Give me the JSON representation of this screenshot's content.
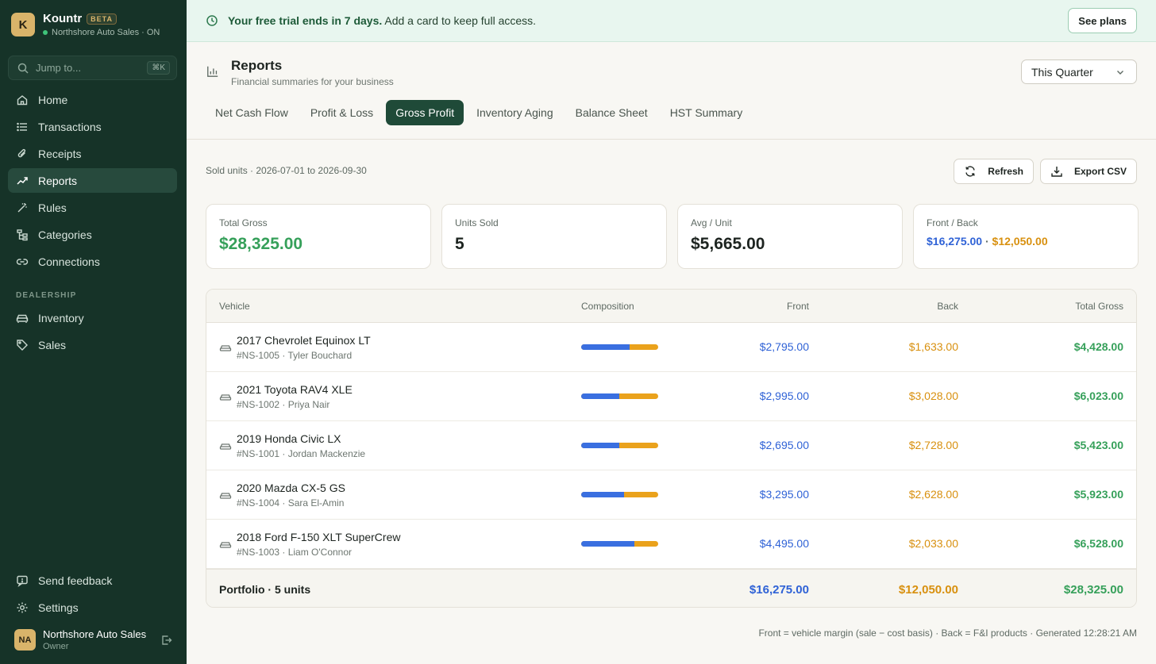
{
  "brand": {
    "logo_letter": "K",
    "name": "Kountr",
    "badge": "BETA",
    "subtitle": "Northshore Auto Sales · ON"
  },
  "search": {
    "placeholder": "Jump to...",
    "shortcut": "⌘K"
  },
  "sidebar": {
    "items": [
      {
        "label": "Home",
        "icon": "home-icon"
      },
      {
        "label": "Transactions",
        "icon": "list-icon"
      },
      {
        "label": "Receipts",
        "icon": "paperclip-icon"
      },
      {
        "label": "Reports",
        "icon": "trend-icon",
        "active": true
      },
      {
        "label": "Rules",
        "icon": "wand-icon"
      },
      {
        "label": "Categories",
        "icon": "tree-icon"
      },
      {
        "label": "Connections",
        "icon": "link-icon"
      }
    ],
    "section_label": "DEALERSHIP",
    "dealership_items": [
      {
        "label": "Inventory",
        "icon": "car-icon"
      },
      {
        "label": "Sales",
        "icon": "tag-icon"
      }
    ],
    "bottom_items": [
      {
        "label": "Send feedback",
        "icon": "feedback-icon"
      },
      {
        "label": "Settings",
        "icon": "gear-icon"
      }
    ]
  },
  "user": {
    "initials": "NA",
    "name": "Northshore Auto Sales",
    "role": "Owner"
  },
  "banner": {
    "bold": "Your free trial ends in 7 days.",
    "text": " Add a card to keep full access.",
    "button": "See plans"
  },
  "header": {
    "title": "Reports",
    "subtitle": "Financial summaries for your business",
    "period": "This Quarter"
  },
  "tabs": [
    {
      "label": "Net Cash Flow"
    },
    {
      "label": "Profit & Loss"
    },
    {
      "label": "Gross Profit",
      "active": true
    },
    {
      "label": "Inventory Aging"
    },
    {
      "label": "Balance Sheet"
    },
    {
      "label": "HST Summary"
    }
  ],
  "report": {
    "meta": "Sold units · 2026-07-01 to 2026-09-30",
    "refresh_label": "Refresh",
    "export_label": "Export CSV",
    "cards": {
      "total_gross": {
        "label": "Total Gross",
        "value": "$28,325.00"
      },
      "units_sold": {
        "label": "Units Sold",
        "value": "5"
      },
      "avg_unit": {
        "label": "Avg / Unit",
        "value": "$5,665.00"
      },
      "front_back": {
        "label": "Front / Back",
        "front": "$16,275.00",
        "sep": " · ",
        "back": "$12,050.00"
      }
    },
    "columns": {
      "vehicle": "Vehicle",
      "composition": "Composition",
      "front": "Front",
      "back": "Back",
      "total": "Total Gross"
    },
    "rows": [
      {
        "name": "2017 Chevrolet Equinox LT",
        "sub": "#NS-1005 · Tyler Bouchard",
        "front": "$2,795.00",
        "back": "$1,633.00",
        "total": "$4,428.00",
        "front_share": 0.631
      },
      {
        "name": "2021 Toyota RAV4 XLE",
        "sub": "#NS-1002 · Priya Nair",
        "front": "$2,995.00",
        "back": "$3,028.00",
        "total": "$6,023.00",
        "front_share": 0.497
      },
      {
        "name": "2019 Honda Civic LX",
        "sub": "#NS-1001 · Jordan Mackenzie",
        "front": "$2,695.00",
        "back": "$2,728.00",
        "total": "$5,423.00",
        "front_share": 0.497
      },
      {
        "name": "2020 Mazda CX-5 GS",
        "sub": "#NS-1004 · Sara El-Amin",
        "front": "$3,295.00",
        "back": "$2,628.00",
        "total": "$5,923.00",
        "front_share": 0.556
      },
      {
        "name": "2018 Ford F-150 XLT SuperCrew",
        "sub": "#NS-1003 · Liam O'Connor",
        "front": "$4,495.00",
        "back": "$2,033.00",
        "total": "$6,528.00",
        "front_share": 0.689
      }
    ],
    "footer": {
      "label": "Portfolio · 5 units",
      "front": "$16,275.00",
      "back": "$12,050.00",
      "total": "$28,325.00"
    },
    "footnote": "Front = vehicle margin (sale − cost basis) · Back = F&I products · Generated 12:28:21 AM"
  },
  "colors": {
    "sidebar_bg": "#163328",
    "accent": "#1f4a38",
    "front": "#2f62d6",
    "back": "#d8900f",
    "gross": "#36a05a"
  }
}
